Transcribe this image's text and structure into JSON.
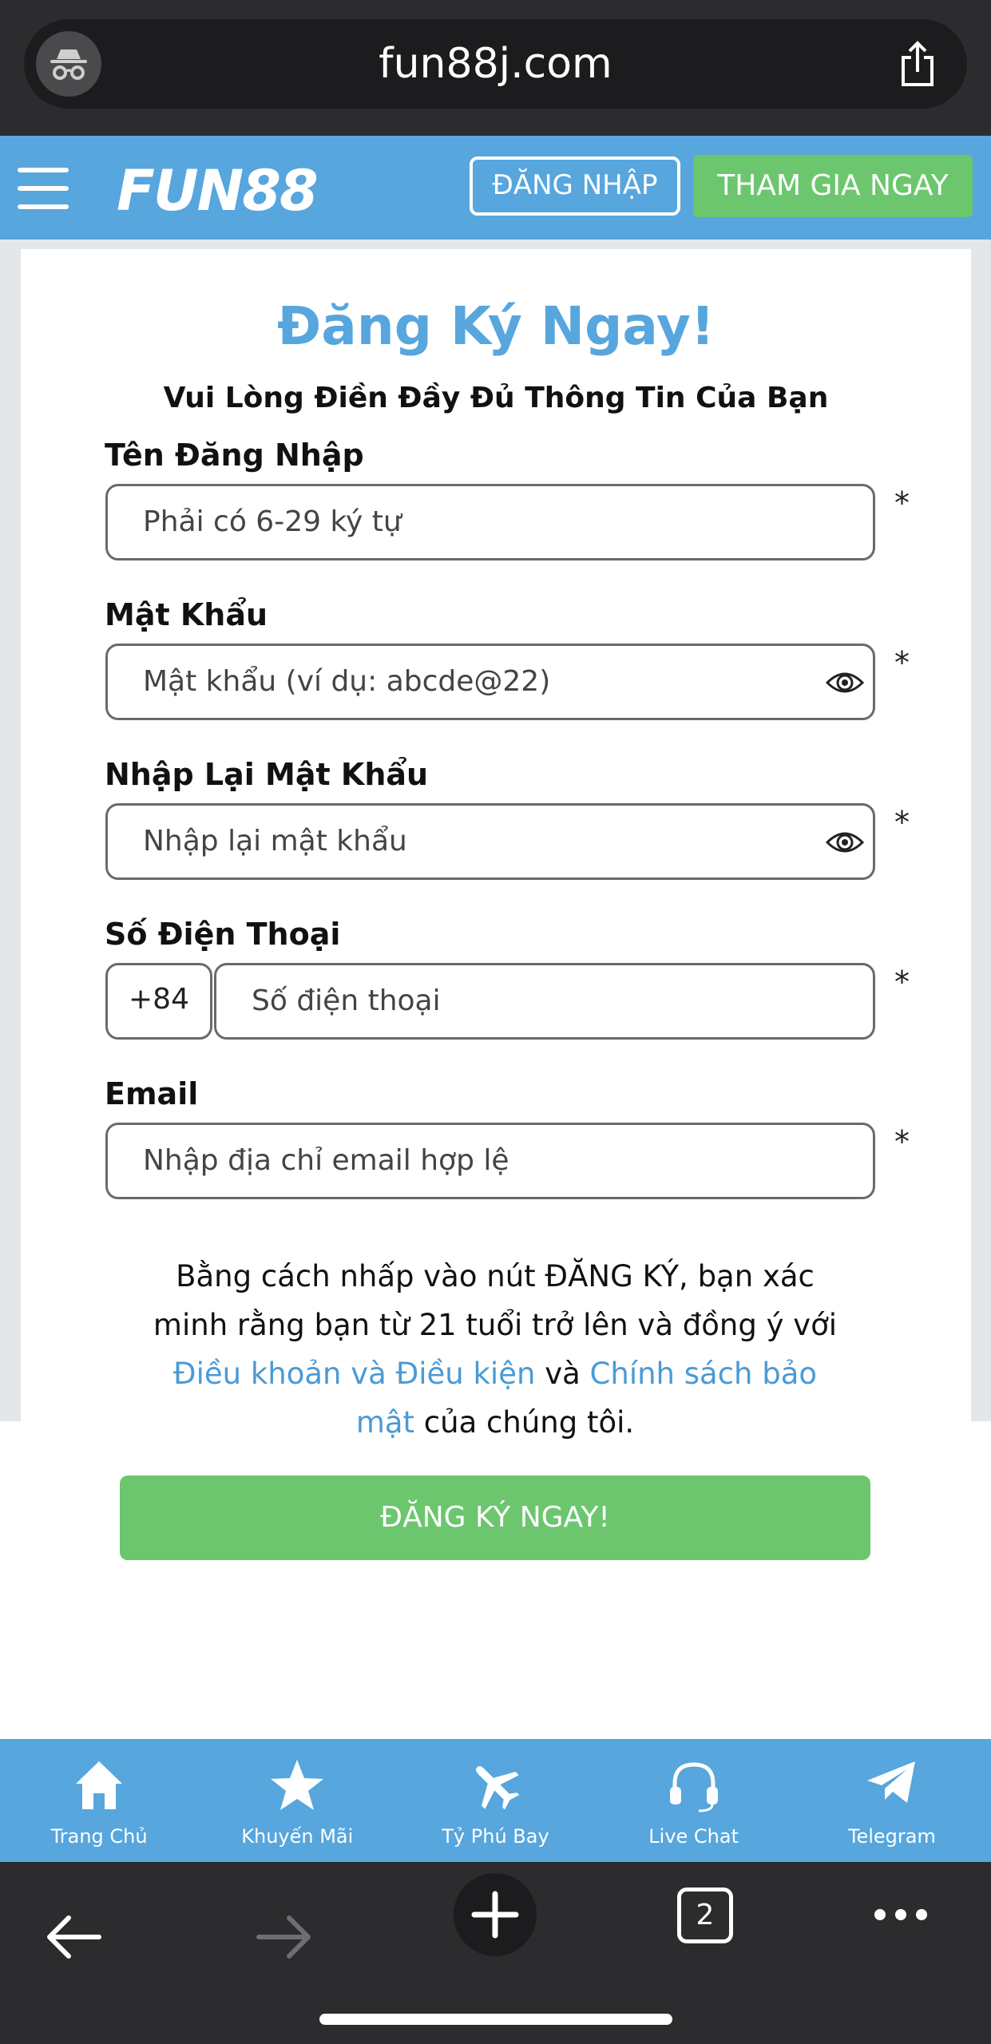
{
  "browser": {
    "url": "fun88j.com",
    "tab_count": "2"
  },
  "header": {
    "logo": "FUN88",
    "login_label": "ĐĂNG NHẬP",
    "join_label": "THAM GIA NGAY"
  },
  "form": {
    "title": "Đăng Ký Ngay!",
    "subtitle": "Vui Lòng Điền Đầy Đủ Thông Tin Của Bạn",
    "username": {
      "label": "Tên Đăng Nhập",
      "placeholder": "Phải có 6-29 ký tự"
    },
    "password": {
      "label": "Mật Khẩu",
      "placeholder": "Mật khẩu (ví dụ: abcde@22)"
    },
    "confirm_password": {
      "label": "Nhập Lại Mật Khẩu",
      "placeholder": "Nhập lại mật khẩu"
    },
    "phone": {
      "label": "Số Điện Thoại",
      "country_code": "+84",
      "placeholder": "Số điện thoại"
    },
    "email": {
      "label": "Email",
      "placeholder": "Nhập địa chỉ email hợp lệ"
    },
    "required_mark": "*",
    "terms": {
      "part1": "Bằng cách nhấp vào nút ĐĂNG KÝ, bạn xác minh rằng bạn từ 21 tuổi trở lên và đồng ý với ",
      "link1": "Điều khoản và Điều kiện",
      "part2": " và ",
      "link2": "Chính sách bảo mật",
      "part3": " của chúng tôi."
    },
    "submit_label": "ĐĂNG KÝ NGAY!"
  },
  "bottom_nav": {
    "items": [
      {
        "label": "Trang Chủ",
        "icon": "home-icon"
      },
      {
        "label": "Khuyến Mãi",
        "icon": "star-icon"
      },
      {
        "label": "Tỷ Phú Bay",
        "icon": "plane-icon"
      },
      {
        "label": "Live Chat",
        "icon": "headset-icon"
      },
      {
        "label": "Telegram",
        "icon": "telegram-icon"
      }
    ]
  },
  "colors": {
    "brand_blue": "#57a6dd",
    "action_green": "#6cc66e",
    "browser_dark": "#2c2c2e"
  }
}
